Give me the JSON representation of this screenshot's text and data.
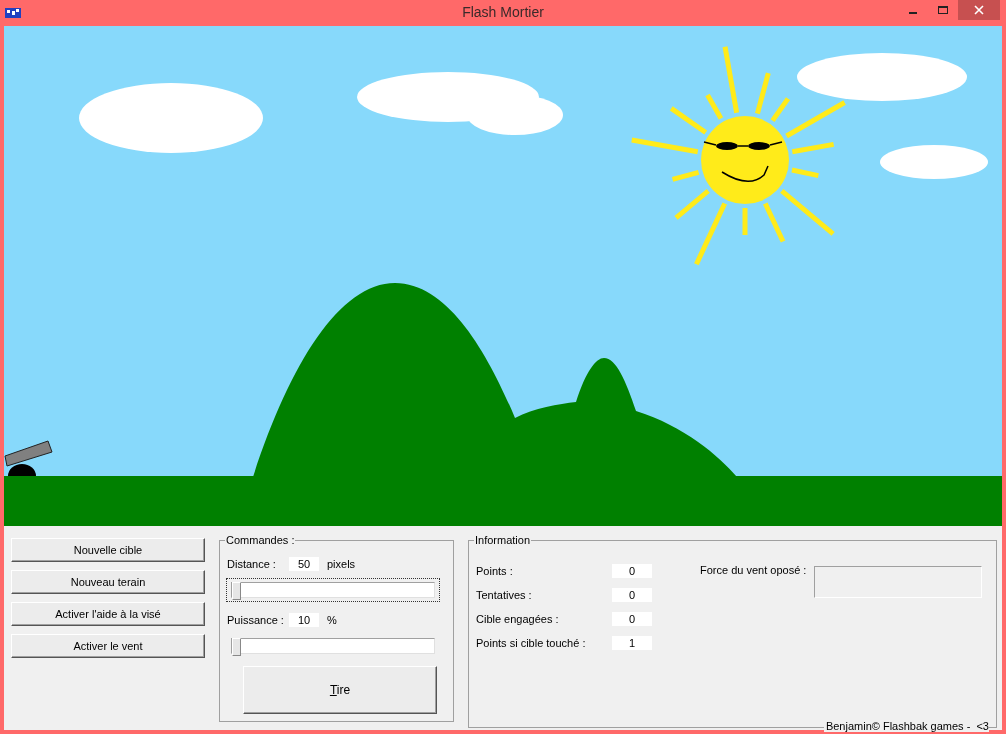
{
  "window": {
    "title": "Flash Mortier"
  },
  "actions": [
    "Nouvelle cible",
    "Nouveau terain",
    "Activer l'aide à la visé",
    "Activer le vent"
  ],
  "commands": {
    "title": "Commandes :",
    "sliders": [
      {
        "label": "Distance :",
        "value": "50",
        "unit": "pixels",
        "level": 0,
        "focused": true
      },
      {
        "label": "Puissance :",
        "value": "10",
        "unit": "%",
        "level": 0,
        "focused": false
      }
    ],
    "fire_button": "Tire"
  },
  "information": {
    "title": "Information",
    "stats": [
      {
        "label": "Points :",
        "value": "0"
      },
      {
        "label": "Tentatives :",
        "value": "0"
      },
      {
        "label": "Cible engagées :",
        "value": "0"
      },
      {
        "label": "Points si cible touché :",
        "value": "1"
      }
    ],
    "wind": {
      "label": "Force du vent oposé :"
    }
  },
  "footer": "Benjamin© Flashbak games -  <3"
}
